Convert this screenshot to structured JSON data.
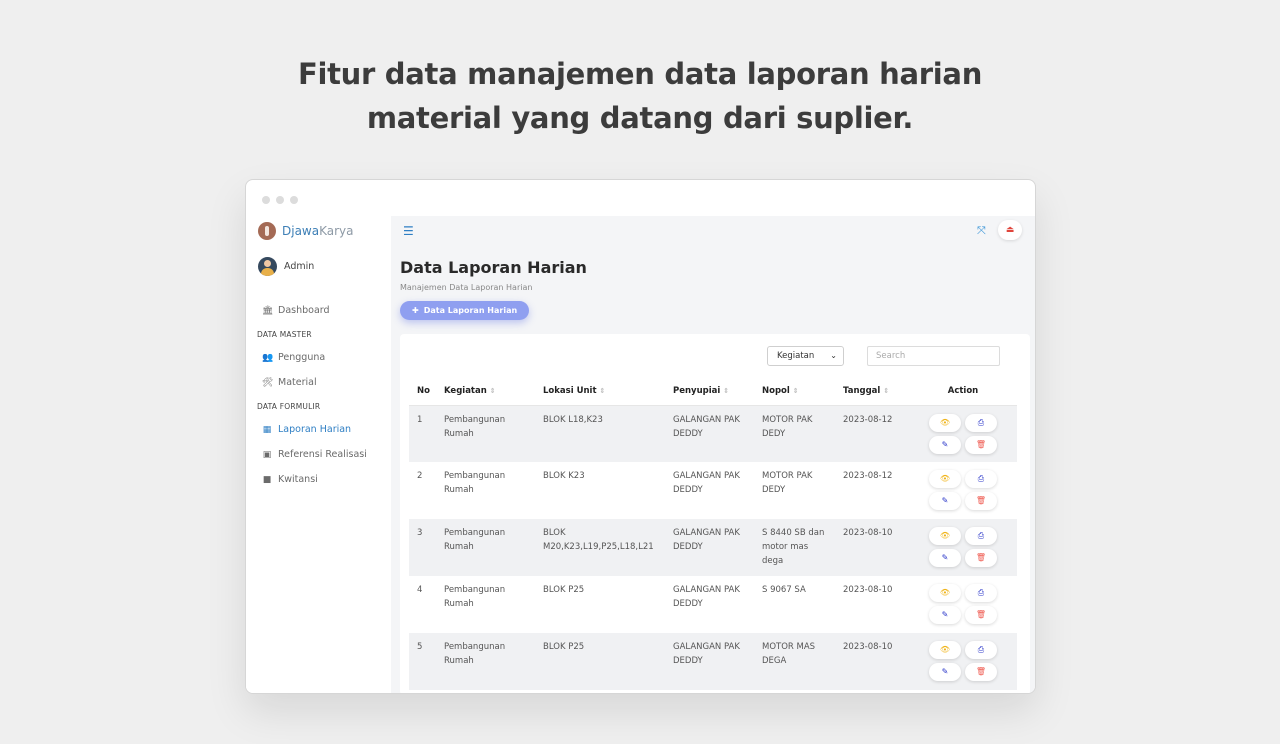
{
  "headline": {
    "line1": "Fitur data manajemen data laporan harian",
    "line2": "material yang datang dari suplier."
  },
  "sidebar": {
    "brand_part1": "Djawa",
    "brand_part2": "Karya",
    "user_name": "Admin",
    "items": [
      {
        "type": "item",
        "label": "Dashboard",
        "icon": "bank-icon"
      },
      {
        "type": "section",
        "label": "DATA MASTER"
      },
      {
        "type": "item",
        "label": "Pengguna",
        "icon": "users-icon"
      },
      {
        "type": "item",
        "label": "Material",
        "icon": "tools-icon"
      },
      {
        "type": "section",
        "label": "DATA FORMULIR"
      },
      {
        "type": "item",
        "label": "Laporan Harian",
        "icon": "calendar-icon",
        "active": true
      },
      {
        "type": "item",
        "label": "Referensi Realisasi",
        "icon": "calendar-check-icon"
      },
      {
        "type": "item",
        "label": "Kwitansi",
        "icon": "receipt-icon"
      }
    ]
  },
  "main": {
    "title": "Data Laporan Harian",
    "subtitle": "Manajemen Data Laporan Harian",
    "add_button": "Data Laporan Harian",
    "filter_value": "Kegiatan",
    "search_placeholder": "Search"
  },
  "table": {
    "columns": [
      "No",
      "Kegiatan",
      "Lokasi Unit",
      "Penyupiai",
      "Nopol",
      "Tanggal",
      "Action"
    ],
    "rows": [
      {
        "no": "1",
        "kegiatan": "Pembangunan Rumah",
        "lokasi": "BLOK L18,K23",
        "penyuplai": "GALANGAN PAK DEDDY",
        "nopol": "MOTOR PAK DEDY",
        "tanggal": "2023-08-12"
      },
      {
        "no": "2",
        "kegiatan": "Pembangunan Rumah",
        "lokasi": "BLOK K23",
        "penyuplai": "GALANGAN PAK DEDDY",
        "nopol": "MOTOR PAK DEDY",
        "tanggal": "2023-08-12"
      },
      {
        "no": "3",
        "kegiatan": "Pembangunan Rumah",
        "lokasi": "BLOK M20,K23,L19,P25,L18,L21",
        "penyuplai": "GALANGAN PAK DEDDY",
        "nopol": "S 8440 SB dan motor mas dega",
        "tanggal": "2023-08-10"
      },
      {
        "no": "4",
        "kegiatan": "Pembangunan Rumah",
        "lokasi": "BLOK P25",
        "penyuplai": "GALANGAN PAK DEDDY",
        "nopol": "S 9067 SA",
        "tanggal": "2023-08-10"
      },
      {
        "no": "5",
        "kegiatan": "Pembangunan Rumah",
        "lokasi": "BLOK P25",
        "penyuplai": "GALANGAN PAK DEDDY",
        "nopol": "MOTOR MAS DEGA",
        "tanggal": "2023-08-10"
      }
    ]
  },
  "colors": {
    "accent": "#2f7fc4",
    "add_button": "#8f9ff0",
    "view": "#f0b41a",
    "print_edit": "#2a36c9",
    "delete": "#ef5a50"
  }
}
